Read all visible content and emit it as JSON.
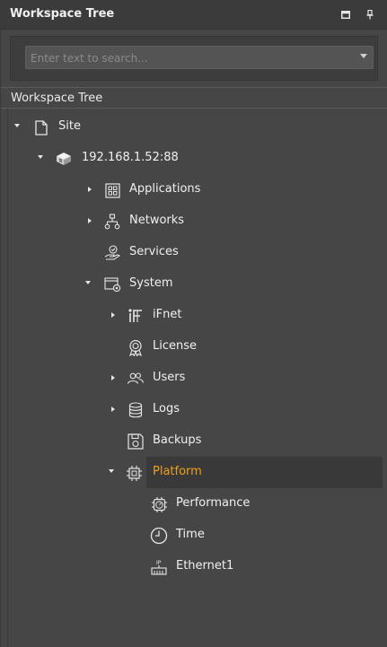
{
  "panel": {
    "title": "Workspace Tree",
    "maximize_icon": "maximize-icon",
    "pin_icon": "pin-icon"
  },
  "search": {
    "placeholder": "Enter text to search...",
    "value": ""
  },
  "section": {
    "label": "Workspace Tree"
  },
  "tree": {
    "site": "Site",
    "server": "192.168.1.52:88",
    "applications": "Applications",
    "networks": "Networks",
    "services": "Services",
    "system": "System",
    "ifnet": "iFnet",
    "license": "License",
    "users": "Users",
    "logs": "Logs",
    "backups": "Backups",
    "platform": "Platform",
    "performance": "Performance",
    "time": "Time",
    "ethernet1": "Ethernet1"
  },
  "colors": {
    "selected_text": "#f0a01e",
    "background": "#464646"
  }
}
